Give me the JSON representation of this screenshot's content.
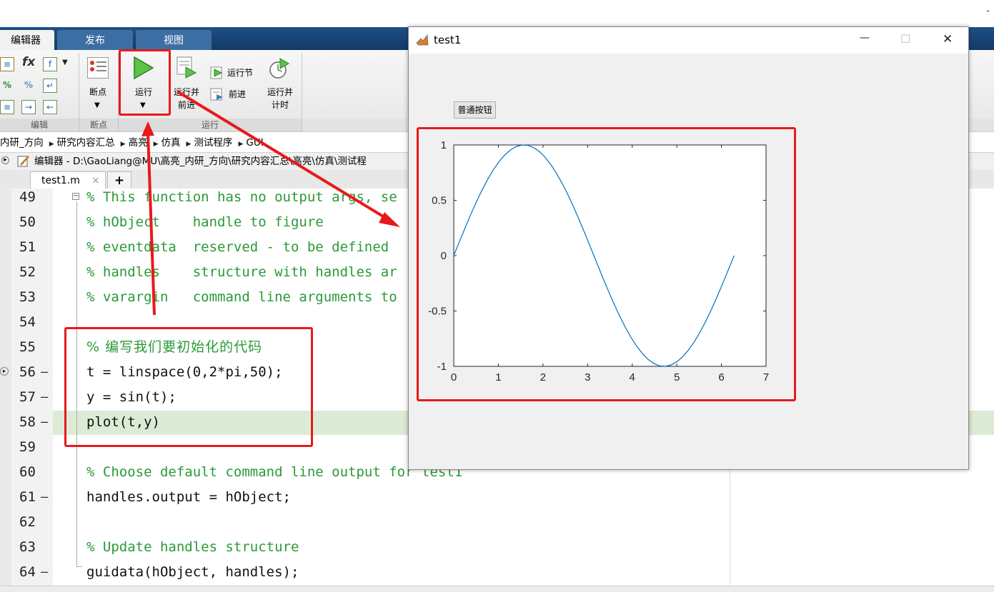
{
  "topbar": {
    "dash": "-"
  },
  "ribbon_tabs": [
    {
      "label": "编辑器"
    },
    {
      "label": "发布"
    },
    {
      "label": "视图"
    }
  ],
  "ribbon": {
    "breakpoint_label": "断点",
    "run_label": "运行",
    "run_advance_label_1": "运行并",
    "run_advance_label_2": "前进",
    "run_section_label": "运行节",
    "advance_label": "前进",
    "run_time_label_1": "运行并",
    "run_time_label_2": "计时",
    "group_edit": "编辑",
    "group_breakpoints": "断点",
    "group_run": "运行",
    "fx_icon_text": "fx"
  },
  "breadcrumb": [
    "内研_方向",
    "研究内容汇总",
    "高亮",
    "仿真",
    "测试程序",
    "GUI"
  ],
  "editor": {
    "title": "编辑器 - D:\\GaoLiang@MU\\高亮_内研_方向\\研究内容汇总\\高亮\\仿真\\测试程",
    "file_tab": "test1.m",
    "close_glyph": "×",
    "add_tab": "+"
  },
  "code_lines": [
    {
      "num": "49",
      "dash": "",
      "text": "% This function has no output args, se",
      "comment": true
    },
    {
      "num": "50",
      "dash": "",
      "text": "% hObject    handle to figure",
      "comment": true
    },
    {
      "num": "51",
      "dash": "",
      "text": "% eventdata  reserved - to be defined",
      "comment": true
    },
    {
      "num": "52",
      "dash": "",
      "text": "% handles    structure with handles ar",
      "comment": true
    },
    {
      "num": "53",
      "dash": "",
      "text": "% varargin   command line arguments to",
      "comment": true
    },
    {
      "num": "54",
      "dash": "",
      "text": "",
      "comment": false
    },
    {
      "num": "55",
      "dash": "",
      "text": "% 编写我们要初始化的代码",
      "comment": true
    },
    {
      "num": "56",
      "dash": "—",
      "text": "t = linspace(0,2*pi,50);",
      "comment": false
    },
    {
      "num": "57",
      "dash": "—",
      "text": "y = sin(t);",
      "comment": false
    },
    {
      "num": "58",
      "dash": "—",
      "text": "plot(t,y)",
      "comment": false
    },
    {
      "num": "59",
      "dash": "",
      "text": "",
      "comment": false
    },
    {
      "num": "60",
      "dash": "",
      "text": "% Choose default command line output for test1",
      "comment": true
    },
    {
      "num": "61",
      "dash": "—",
      "text": "handles.output = hObject;",
      "comment": false
    },
    {
      "num": "62",
      "dash": "",
      "text": "",
      "comment": false
    },
    {
      "num": "63",
      "dash": "",
      "text": "% Update handles structure",
      "comment": true
    },
    {
      "num": "64",
      "dash": "—",
      "text": "guidata(hObject, handles);",
      "comment": false
    }
  ],
  "figure_window": {
    "title": "test1",
    "minimize_glyph": "—",
    "maximize_glyph": "☐",
    "close_glyph": "✕",
    "push_button": "普通按钮"
  },
  "colors": {
    "comment": "#2a9a37",
    "highlight_line": "#dcebd6",
    "annotation_red": "#e8191b",
    "plot_line": "#0072bd"
  },
  "chart_data": {
    "type": "line",
    "title": "",
    "xlabel": "",
    "ylabel": "",
    "xlim": [
      0,
      7
    ],
    "ylim": [
      -1,
      1
    ],
    "xticks": [
      0,
      1,
      2,
      3,
      4,
      5,
      6,
      7
    ],
    "yticks": [
      -1,
      -0.5,
      0,
      0.5,
      1
    ],
    "series": [
      {
        "function": "y = sin(t)",
        "x_start": 0,
        "x_end": 6.2832,
        "points": 50
      }
    ],
    "grid": false
  }
}
